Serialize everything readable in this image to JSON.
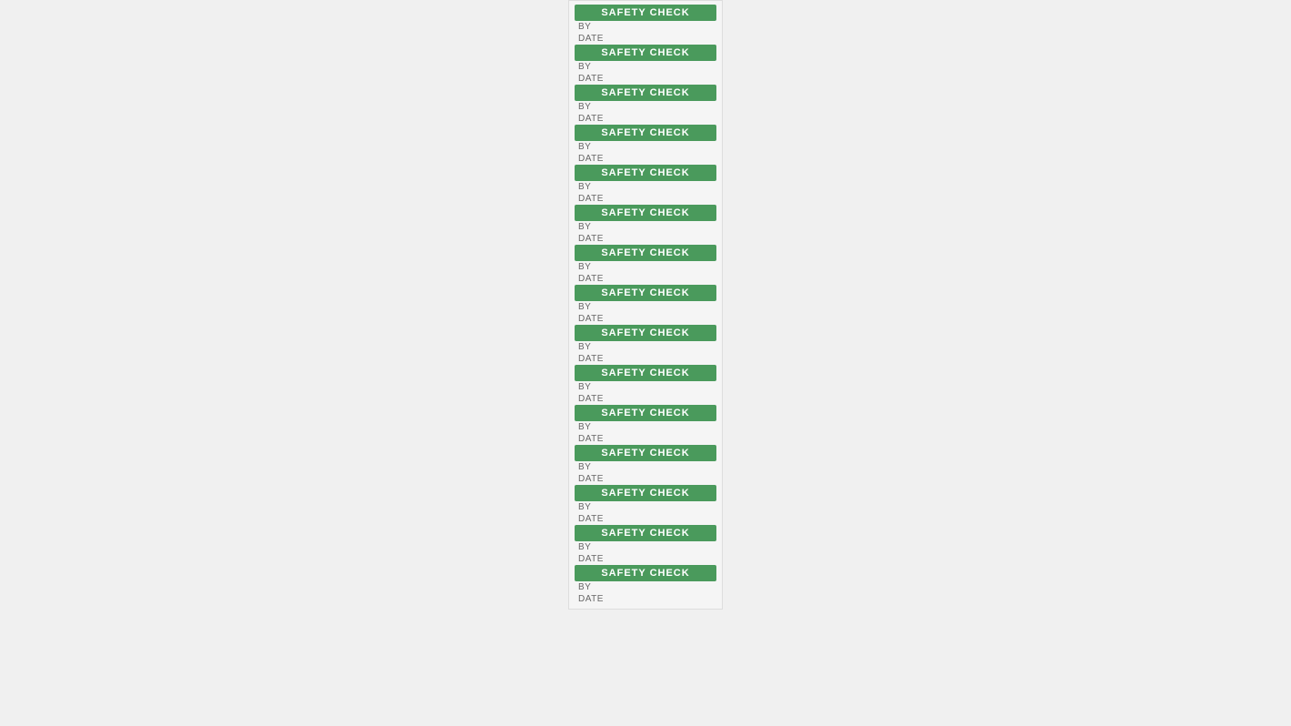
{
  "page": {
    "background": "#f0f0f0"
  },
  "card": {
    "header_label": "SAFETY CHECK",
    "by_label": "BY",
    "date_label": "DATE",
    "blocks": [
      {
        "id": 1
      },
      {
        "id": 2
      },
      {
        "id": 3
      },
      {
        "id": 4
      },
      {
        "id": 5
      },
      {
        "id": 6
      },
      {
        "id": 7
      },
      {
        "id": 8
      },
      {
        "id": 9
      },
      {
        "id": 10
      },
      {
        "id": 11
      },
      {
        "id": 12
      },
      {
        "id": 13
      },
      {
        "id": 14
      },
      {
        "id": 15
      }
    ]
  }
}
